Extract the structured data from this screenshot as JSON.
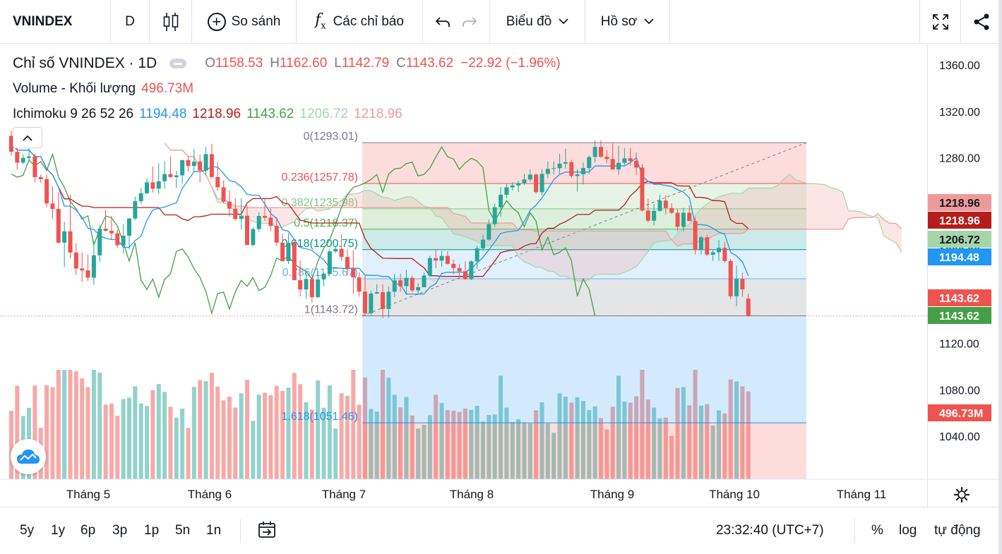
{
  "toolbar": {
    "symbol": "VNINDEX",
    "interval": "D",
    "compare_label": "So sánh",
    "indicators_label": "Các chỉ báo",
    "charttype_label": "Biểu đồ",
    "profile_label": "Hồ sơ",
    "icons": [
      "candlestick-icon",
      "plus-circle-icon",
      "fx-icon",
      "undo-icon",
      "redo-icon",
      "chevron-down-icon",
      "fullscreen-icon",
      "share-icon"
    ]
  },
  "legend": {
    "title": "Chỉ số VNINDEX · 1D",
    "o_label": "O",
    "o": "1158.53",
    "h_label": "H",
    "h": "1162.60",
    "l_label": "L",
    "l": "1142.79",
    "c_label": "C",
    "c": "1143.62",
    "change": "−22.92 (−1.96%)",
    "volume_label": "Volume - Khối lượng",
    "volume": "496.73M",
    "ichimoku_label": "Ichimoku 9 26 52 26",
    "ichimoku_values": [
      "1194.48",
      "1218.96",
      "1143.62",
      "1206.72",
      "1218.96"
    ]
  },
  "chart_data": {
    "type": "candlestick",
    "price_axis": {
      "ylim": [
        1010.0,
        1370.0
      ],
      "ticks": [
        1040,
        1080,
        1120,
        1160,
        1200,
        1240,
        1280,
        1320,
        1360
      ]
    },
    "tick_labels": [
      "1040.00",
      "1080.00",
      "1120.00",
      "1160.00",
      "1200.00",
      "1240.00",
      "1280.00",
      "1320.00",
      "1360.00"
    ],
    "x_labels": [
      "Tháng 5",
      "Tháng 6",
      "Tháng 7",
      "Tháng 8",
      "Tháng 9",
      "Tháng 10",
      "Tháng 11"
    ],
    "price_badges": [
      {
        "value": "1218.96",
        "color": "#ef9a9a",
        "text_color": "#131722"
      },
      {
        "value": "1218.96",
        "color": "#b71c1c",
        "text_color": "#ffffff"
      },
      {
        "value": "1206.72",
        "color": "#a5d6a7",
        "text_color": "#131722"
      },
      {
        "value": "1194.48",
        "color": "#2196f3",
        "text_color": "#ffffff"
      },
      {
        "value": "1143.62",
        "color": "#ef5350",
        "text_color": "#ffffff"
      },
      {
        "value": "1143.62",
        "color": "#43a047",
        "text_color": "#ffffff"
      },
      {
        "value": "496.73M",
        "color": "#ef5350",
        "text_color": "#ffffff",
        "volume": true
      }
    ],
    "fibonacci": [
      {
        "ratio": "0",
        "price": 1293.01,
        "label": "0(1293.01)",
        "color": "#787b86"
      },
      {
        "ratio": "0.236",
        "price": 1257.78,
        "label": "0.236(1257.78)",
        "color": "#ef5350"
      },
      {
        "ratio": "0.382",
        "price": 1235.98,
        "label": "0.382(1235.98)",
        "color": "#81c784"
      },
      {
        "ratio": "0.5",
        "price": 1218.37,
        "label": "0.5(1218.37)",
        "color": "#4caf50"
      },
      {
        "ratio": "0.618",
        "price": 1200.75,
        "label": "0.618(1200.75)",
        "color": "#009688"
      },
      {
        "ratio": "0.786",
        "price": 1175.67,
        "label": "0.786(1175.67)",
        "color": "#64b5f6"
      },
      {
        "ratio": "1",
        "price": 1143.72,
        "label": "1(1143.72)",
        "color": "#787b86"
      },
      {
        "ratio": "1.618",
        "price": 1051.46,
        "label": "1.618(1051.46)",
        "color": "#2196f3"
      }
    ],
    "candles": [
      [
        1298.9,
        1303.4,
        1281.8,
        1285.1
      ],
      [
        1285.1,
        1290.8,
        1269.7,
        1275.8
      ],
      [
        1275.8,
        1283.1,
        1274.5,
        1279.8
      ],
      [
        1279.8,
        1290.8,
        1277.2,
        1281.2
      ],
      [
        1281.2,
        1284.0,
        1258.9,
        1263.3
      ],
      [
        1263.3,
        1265.4,
        1258.4,
        1261.5
      ],
      [
        1261.5,
        1265.6,
        1237.8,
        1240.6
      ],
      [
        1240.6,
        1255.4,
        1227.2,
        1235.8
      ],
      [
        1235.8,
        1250.4,
        1206.1,
        1206.8
      ],
      [
        1206.8,
        1224.8,
        1185.7,
        1216.6
      ],
      [
        1216.6,
        1248.3,
        1193.3,
        1198.3
      ],
      [
        1198.3,
        1206.3,
        1178.9,
        1184.5
      ],
      [
        1184.5,
        1198.5,
        1173.1,
        1182.9
      ],
      [
        1182.9,
        1196.4,
        1173.7,
        1176.6
      ],
      [
        1176.6,
        1208.3,
        1170.7,
        1195.9
      ],
      [
        1195.9,
        1222.1,
        1190.1,
        1218.8
      ],
      [
        1218.8,
        1234.9,
        1216.3,
        1217.0
      ],
      [
        1217.0,
        1229.7,
        1209.3,
        1214.8
      ],
      [
        1214.8,
        1218.1,
        1202.0,
        1204.5
      ],
      [
        1204.5,
        1222.6,
        1197.6,
        1212.8
      ],
      [
        1212.8,
        1228.0,
        1201.1,
        1227.6
      ],
      [
        1227.6,
        1246.3,
        1226.1,
        1242.5
      ],
      [
        1242.5,
        1254.1,
        1240.4,
        1249.4
      ],
      [
        1249.4,
        1262.1,
        1248.3,
        1258.8
      ],
      [
        1258.8,
        1272.4,
        1250.1,
        1253.3
      ],
      [
        1253.3,
        1275.2,
        1248.8,
        1259.7
      ],
      [
        1259.7,
        1277.3,
        1253.2,
        1265.9
      ],
      [
        1265.9,
        1281.1,
        1262.5,
        1263.3
      ],
      [
        1263.3,
        1268.7,
        1253.8,
        1264.8
      ],
      [
        1264.8,
        1278.1,
        1257.8,
        1278.0
      ],
      [
        1278.0,
        1280.9,
        1268.1,
        1272.9
      ],
      [
        1272.9,
        1287.6,
        1268.0,
        1276.7
      ],
      [
        1276.7,
        1282.8,
        1258.8,
        1269.0
      ],
      [
        1269.0,
        1289.3,
        1264.5,
        1283.1
      ],
      [
        1283.1,
        1292.0,
        1262.0,
        1263.4
      ],
      [
        1263.4,
        1276.5,
        1251.6,
        1254.5
      ],
      [
        1254.5,
        1260.4,
        1240.5,
        1242.2
      ],
      [
        1242.2,
        1251.9,
        1229.0,
        1236.1
      ],
      [
        1236.1,
        1245.2,
        1226.0,
        1227.2
      ],
      [
        1227.2,
        1245.0,
        1218.0,
        1230.0
      ],
      [
        1230.0,
        1239.3,
        1204.8,
        1204.8
      ],
      [
        1204.8,
        1220.4,
        1203.4,
        1218.5
      ],
      [
        1218.5,
        1233.1,
        1216.1,
        1229.8
      ],
      [
        1229.8,
        1244.7,
        1225.5,
        1228.3
      ],
      [
        1228.3,
        1236.1,
        1216.7,
        1221.2
      ],
      [
        1221.2,
        1228.7,
        1203.8,
        1206.8
      ],
      [
        1206.8,
        1214.4,
        1190.5,
        1190.9
      ],
      [
        1190.9,
        1215.0,
        1188.3,
        1206.8
      ],
      [
        1206.8,
        1209.0,
        1174.3,
        1174.5
      ],
      [
        1174.5,
        1191.5,
        1160.6,
        1166.4
      ],
      [
        1166.4,
        1182.2,
        1158.3,
        1175.5
      ],
      [
        1175.5,
        1177.3,
        1155.5,
        1159.8
      ],
      [
        1159.8,
        1182.2,
        1159.0,
        1175.1
      ],
      [
        1175.1,
        1181.3,
        1169.3,
        1179.9
      ],
      [
        1179.9,
        1201.8,
        1178.3,
        1199.3
      ],
      [
        1199.3,
        1202.9,
        1197.8,
        1201.4
      ],
      [
        1201.4,
        1213.8,
        1191.3,
        1194.5
      ],
      [
        1194.5,
        1201.4,
        1178.8,
        1184.3
      ],
      [
        1184.3,
        1200.0,
        1162.6,
        1176.9
      ],
      [
        1176.9,
        1181.4,
        1160.2,
        1164.6
      ],
      [
        1164.6,
        1178.9,
        1144.0,
        1145.9
      ],
      [
        1145.9,
        1165.2,
        1143.4,
        1162.9
      ],
      [
        1162.9,
        1171.0,
        1162.4,
        1164.1
      ],
      [
        1164.1,
        1170.9,
        1141.6,
        1149.6
      ],
      [
        1149.6,
        1168.7,
        1142.0,
        1164.5
      ],
      [
        1164.5,
        1179.9,
        1159.7,
        1174.3
      ],
      [
        1174.3,
        1180.1,
        1164.4,
        1169.3
      ],
      [
        1169.3,
        1183.5,
        1161.7,
        1176.5
      ],
      [
        1176.5,
        1178.6,
        1164.0,
        1165.6
      ],
      [
        1165.6,
        1171.9,
        1162.0,
        1168.4
      ],
      [
        1168.4,
        1181.2,
        1168.3,
        1178.4
      ],
      [
        1178.4,
        1195.5,
        1176.9,
        1193.5
      ],
      [
        1193.5,
        1200.8,
        1184.8,
        1191.3
      ],
      [
        1191.3,
        1199.6,
        1186.1,
        1195.4
      ],
      [
        1195.4,
        1199.4,
        1187.8,
        1188.5
      ],
      [
        1188.5,
        1192.2,
        1179.6,
        1184.9
      ],
      [
        1184.9,
        1188.6,
        1175.3,
        1182.1
      ],
      [
        1182.1,
        1190.8,
        1174.6,
        1175.3
      ],
      [
        1175.3,
        1191.4,
        1174.5,
        1190.7
      ],
      [
        1190.7,
        1204.0,
        1184.0,
        1201.9
      ],
      [
        1201.9,
        1213.6,
        1199.5,
        1209.4
      ],
      [
        1209.4,
        1226.8,
        1208.4,
        1222.8
      ],
      [
        1222.8,
        1240.3,
        1220.4,
        1237.3
      ],
      [
        1237.3,
        1254.8,
        1229.1,
        1248.1
      ],
      [
        1248.1,
        1257.6,
        1245.2,
        1254.5
      ],
      [
        1254.5,
        1259.0,
        1251.9,
        1256.1
      ],
      [
        1256.1,
        1260.1,
        1250.4,
        1258.2
      ],
      [
        1258.2,
        1266.0,
        1256.5,
        1261.3
      ],
      [
        1261.3,
        1269.9,
        1259.6,
        1265.5
      ],
      [
        1265.5,
        1266.5,
        1248.9,
        1250.3
      ],
      [
        1250.3,
        1270.2,
        1247.6,
        1266.0
      ],
      [
        1266.0,
        1276.7,
        1262.5,
        1270.4
      ],
      [
        1270.4,
        1276.9,
        1265.7,
        1271.0
      ],
      [
        1271.0,
        1283.4,
        1266.1,
        1274.9
      ],
      [
        1274.9,
        1287.7,
        1270.6,
        1276.2
      ],
      [
        1276.2,
        1278.2,
        1262.6,
        1264.3
      ],
      [
        1264.3,
        1270.2,
        1250.8,
        1265.7
      ],
      [
        1265.7,
        1275.9,
        1256.9,
        1271.1
      ],
      [
        1271.1,
        1282.1,
        1266.0,
        1280.6
      ],
      [
        1280.6,
        1295.0,
        1275.9,
        1289.3
      ],
      [
        1289.3,
        1295.0,
        1280.0,
        1280.8
      ],
      [
        1280.8,
        1286.5,
        1275.4,
        1278.9
      ],
      [
        1278.9,
        1292.3,
        1269.5,
        1269.9
      ],
      [
        1269.9,
        1290.2,
        1265.2,
        1275.6
      ],
      [
        1275.6,
        1288.3,
        1273.8,
        1279.5
      ],
      [
        1279.5,
        1288.5,
        1273.2,
        1277.2
      ],
      [
        1277.2,
        1284.6,
        1265.1,
        1271.5
      ],
      [
        1271.5,
        1274.4,
        1233.6,
        1234.5
      ],
      [
        1234.5,
        1244.8,
        1224.2,
        1225.7
      ],
      [
        1225.7,
        1240.1,
        1221.9,
        1234.2
      ],
      [
        1234.2,
        1248.2,
        1233.6,
        1243.1
      ],
      [
        1243.1,
        1247.5,
        1231.3,
        1236.6
      ],
      [
        1236.6,
        1240.8,
        1231.6,
        1232.5
      ],
      [
        1232.5,
        1235.7,
        1216.6,
        1220.5
      ],
      [
        1220.5,
        1237.0,
        1216.2,
        1232.6
      ],
      [
        1232.6,
        1239.0,
        1225.2,
        1225.4
      ],
      [
        1225.4,
        1228.7,
        1196.6,
        1200.4
      ],
      [
        1200.4,
        1212.8,
        1196.6,
        1211.4
      ],
      [
        1211.4,
        1213.5,
        1195.3,
        1196.4
      ],
      [
        1196.4,
        1200.7,
        1191.0,
        1198.5
      ],
      [
        1198.5,
        1208.9,
        1191.0,
        1202.3
      ],
      [
        1202.3,
        1207.1,
        1189.3,
        1191.0
      ],
      [
        1191.0,
        1192.7,
        1158.1,
        1160.6
      ],
      [
        1160.6,
        1186.9,
        1151.9,
        1175.5
      ],
      [
        1175.5,
        1181.0,
        1160.2,
        1166.5
      ],
      [
        1158.5,
        1162.6,
        1142.8,
        1143.6
      ]
    ],
    "volumes": [],
    "ichimoku": {
      "tenkan_color": "#2196f3",
      "kijun_color": "#b71c1c",
      "chikou_color": "#43a047",
      "span_a_color": "#a5d6a7",
      "span_b_color": "#ef9a9a"
    }
  },
  "bottombar": {
    "ranges": [
      "5y",
      "1y",
      "6p",
      "3p",
      "1p",
      "5n",
      "1n"
    ],
    "time": "23:32:40 (UTC+7)",
    "percent": "%",
    "log": "log",
    "auto": "tự động"
  }
}
